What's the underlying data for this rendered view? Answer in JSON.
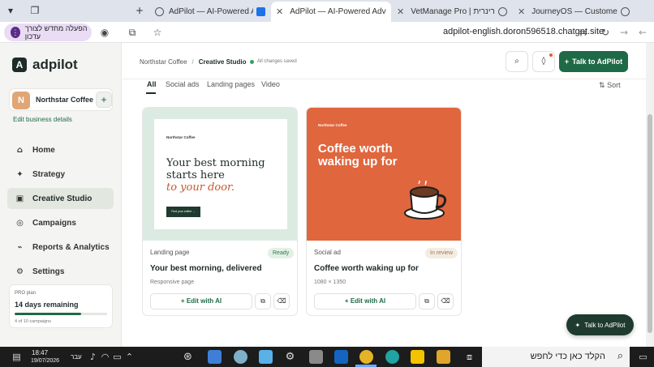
{
  "browser": {
    "tabs": [
      {
        "title": "AdPilot — AI-Powered Advertis",
        "active": false
      },
      {
        "title": "AdPilot — AI-Powered Advertis",
        "active": true
      },
      {
        "title": "VetManage Pro | פאה וטרינרית",
        "active": false
      },
      {
        "title": "JourneyOS — Customer Journey",
        "active": false
      }
    ],
    "reload_chip": "הפעלה מחדש לצורך עדכון",
    "url": "adpilot-english.doron596518.chatgpt.site"
  },
  "sidebar": {
    "logo": "adpilot",
    "logo_mark": "A",
    "business_initial": "N",
    "business_name": "Northstar Coffee",
    "edit_business": "Edit business details",
    "nav": [
      {
        "label": "Home",
        "icon": "home-icon",
        "active": false
      },
      {
        "label": "Strategy",
        "icon": "sparkle-icon",
        "active": false
      },
      {
        "label": "Creative Studio",
        "icon": "image-icon",
        "active": true
      },
      {
        "label": "Campaigns",
        "icon": "target-icon",
        "active": false
      },
      {
        "label": "Reports & Analytics",
        "icon": "chart-icon",
        "active": false
      },
      {
        "label": "Settings",
        "icon": "gear-icon",
        "active": false
      }
    ],
    "plan": {
      "label": "PRO plan",
      "days": "14 days remaining",
      "progress": 0.72,
      "count": "4 of 10 campaigns"
    }
  },
  "header": {
    "breadcrumb_root": "Northstar Coffee",
    "breadcrumb_current": "Creative Studio",
    "saved": "All changes saved",
    "talk_button": "Talk to AdPilot"
  },
  "filters": {
    "tabs": [
      "All",
      "Social ads",
      "Landing pages",
      "Video"
    ],
    "sort": "Sort"
  },
  "cards": [
    {
      "type": "Landing page",
      "status": "Ready",
      "title": "Your best morning, delivered",
      "subtitle": "Responsive page",
      "edit_label": "Edit with AI",
      "preview": {
        "brand": "Northstar Coffee",
        "headline_1": "Your best morning",
        "headline_2": "starts here",
        "headline_3": "to your door.",
        "cta": "Find your coffee →",
        "bg": "#dcebe1"
      }
    },
    {
      "type": "Social ad",
      "status": "In review",
      "title": "Coffee worth waking up for",
      "subtitle": "1080 × 1350",
      "edit_label": "Edit with AI",
      "preview": {
        "brand": "Northstar Coffee",
        "headline_1": "Coffee worth",
        "headline_2": "waking up for",
        "bg": "#e0663e"
      }
    }
  ],
  "floating_talk": "Talk to AdPilot",
  "taskbar": {
    "time": "18:47",
    "date": "19/07/2026",
    "lang": "עבר",
    "search_placeholder": "הקלד כאן כדי לחפש"
  }
}
